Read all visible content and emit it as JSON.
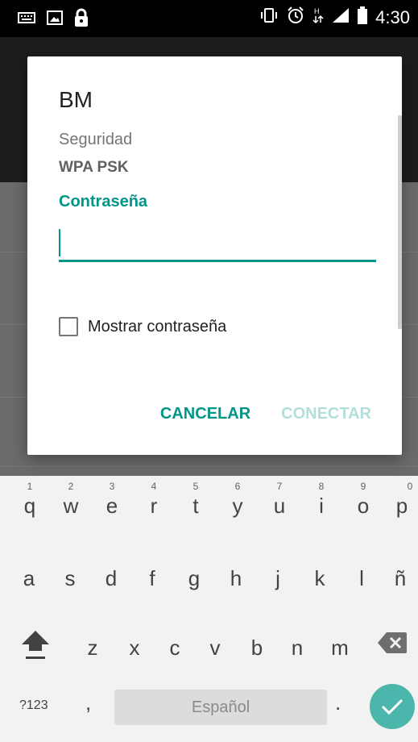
{
  "status_bar": {
    "time": "4:30"
  },
  "dialog": {
    "title": "BM",
    "security_label": "Seguridad",
    "security_value": "WPA PSK",
    "password_label": "Contraseña",
    "password_value": "",
    "show_password_label": "Mostrar contraseña",
    "show_password_checked": false,
    "cancel_label": "CANCELAR",
    "connect_label": "CONECTAR"
  },
  "keyboard": {
    "row1": [
      {
        "key": "q",
        "hint": "1"
      },
      {
        "key": "w",
        "hint": "2"
      },
      {
        "key": "e",
        "hint": "3"
      },
      {
        "key": "r",
        "hint": "4"
      },
      {
        "key": "t",
        "hint": "5"
      },
      {
        "key": "y",
        "hint": "6"
      },
      {
        "key": "u",
        "hint": "7"
      },
      {
        "key": "i",
        "hint": "8"
      },
      {
        "key": "o",
        "hint": "9"
      },
      {
        "key": "p",
        "hint": "0"
      }
    ],
    "row2": [
      "a",
      "s",
      "d",
      "f",
      "g",
      "h",
      "j",
      "k",
      "l",
      "ñ"
    ],
    "row3": [
      "z",
      "x",
      "c",
      "v",
      "b",
      "n",
      "m"
    ],
    "symbols_label": "?123",
    "comma": ",",
    "period": ".",
    "space_label": "Español"
  },
  "colors": {
    "accent": "#009688",
    "accent_disabled": "#b2dfdb",
    "enter_button": "#4db6ac"
  }
}
